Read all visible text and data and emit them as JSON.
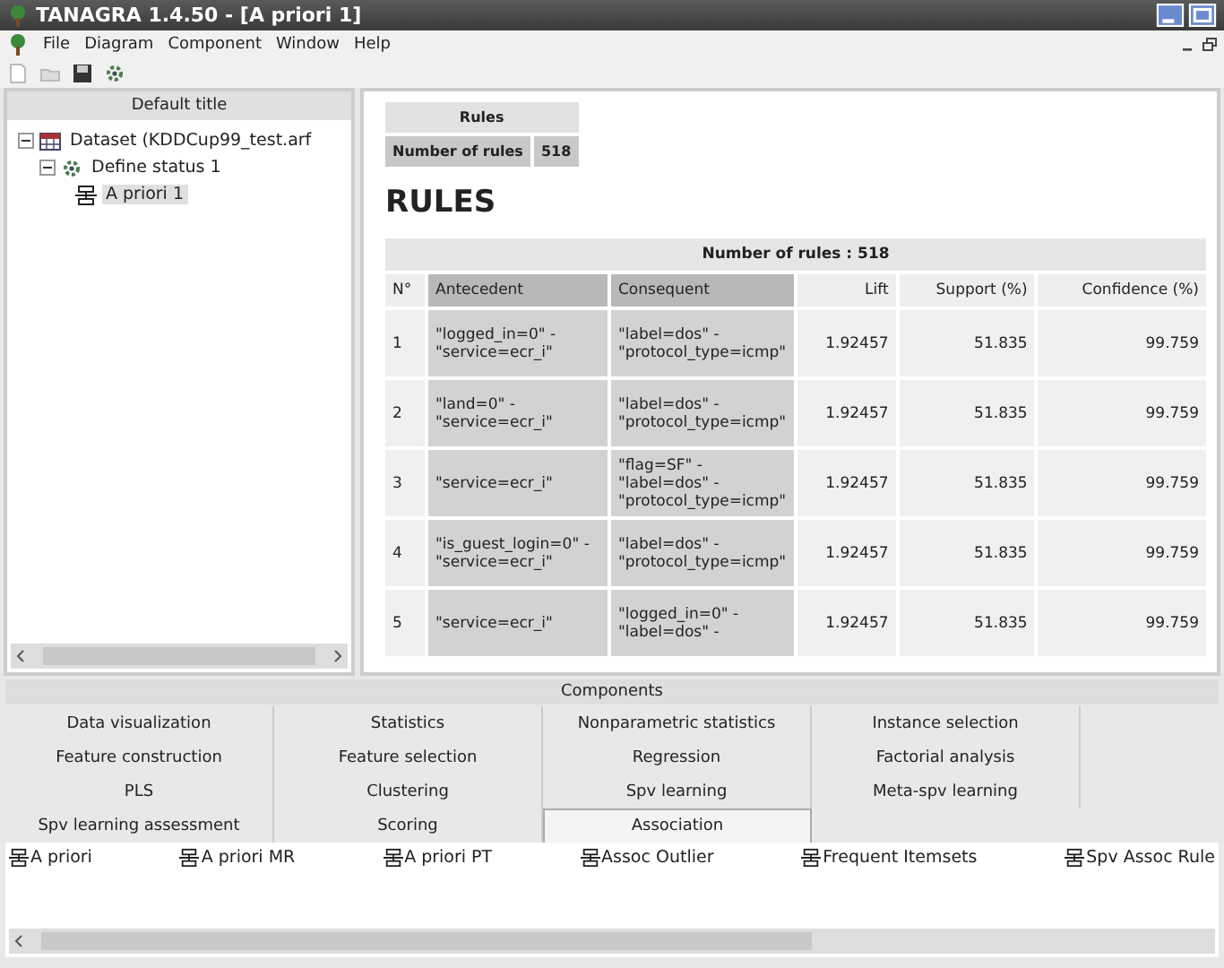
{
  "window": {
    "title": "TANAGRA 1.4.50 - [A priori 1]"
  },
  "menu": [
    "File",
    "Diagram",
    "Component",
    "Window",
    "Help"
  ],
  "tree": {
    "title": "Default title",
    "items": [
      {
        "label": "Dataset (KDDCup99_test.arf",
        "kind": "dataset",
        "expanded": true,
        "selected": false,
        "children": [
          {
            "label": "Define status 1",
            "kind": "status",
            "expanded": true,
            "selected": false,
            "children": [
              {
                "label": "A priori 1",
                "kind": "rule",
                "selected": true
              }
            ]
          }
        ]
      }
    ]
  },
  "summary": {
    "title": "Rules",
    "label": "Number of rules",
    "value": "518"
  },
  "heading": "RULES",
  "table": {
    "caption": "Number of rules : 518",
    "columns": [
      "N°",
      "Antecedent",
      "Consequent",
      "Lift",
      "Support (%)",
      "Confidence (%)"
    ],
    "rows": [
      {
        "n": "1",
        "antecedent": "\"logged_in=0\" - \"service=ecr_i\"",
        "consequent": "\"label=dos\" - \"protocol_type=icmp\"",
        "lift": "1.92457",
        "support": "51.835",
        "confidence": "99.759"
      },
      {
        "n": "2",
        "antecedent": "\"land=0\" - \"service=ecr_i\"",
        "consequent": "\"label=dos\" - \"protocol_type=icmp\"",
        "lift": "1.92457",
        "support": "51.835",
        "confidence": "99.759"
      },
      {
        "n": "3",
        "antecedent": "\"service=ecr_i\"",
        "consequent": "\"flag=SF\" - \"label=dos\" - \"protocol_type=icmp\"",
        "lift": "1.92457",
        "support": "51.835",
        "confidence": "99.759"
      },
      {
        "n": "4",
        "antecedent": "\"is_guest_login=0\" - \"service=ecr_i\"",
        "consequent": "\"label=dos\" - \"protocol_type=icmp\"",
        "lift": "1.92457",
        "support": "51.835",
        "confidence": "99.759"
      },
      {
        "n": "5",
        "antecedent": "\"service=ecr_i\"",
        "consequent": "\"logged_in=0\" - \"label=dos\" -",
        "lift": "1.92457",
        "support": "51.835",
        "confidence": "99.759"
      }
    ]
  },
  "components": {
    "title": "Components",
    "tabs": [
      {
        "label": "Data visualization",
        "selected": false
      },
      {
        "label": "Statistics",
        "selected": false
      },
      {
        "label": "Nonparametric statistics",
        "selected": false
      },
      {
        "label": "Instance selection",
        "selected": false
      },
      {
        "label": "Feature construction",
        "selected": false
      },
      {
        "label": "Feature selection",
        "selected": false
      },
      {
        "label": "Regression",
        "selected": false
      },
      {
        "label": "Factorial analysis",
        "selected": false
      },
      {
        "label": "PLS",
        "selected": false
      },
      {
        "label": "Clustering",
        "selected": false
      },
      {
        "label": "Spv learning",
        "selected": false
      },
      {
        "label": "Meta-spv learning",
        "selected": false
      },
      {
        "label": "Spv learning assessment",
        "selected": false
      },
      {
        "label": "Scoring",
        "selected": false
      },
      {
        "label": "Association",
        "selected": true
      }
    ],
    "items": [
      "A priori",
      "A priori MR",
      "A priori PT",
      "Assoc Outlier",
      "Frequent Itemsets",
      "Spv Assoc Rule"
    ]
  }
}
